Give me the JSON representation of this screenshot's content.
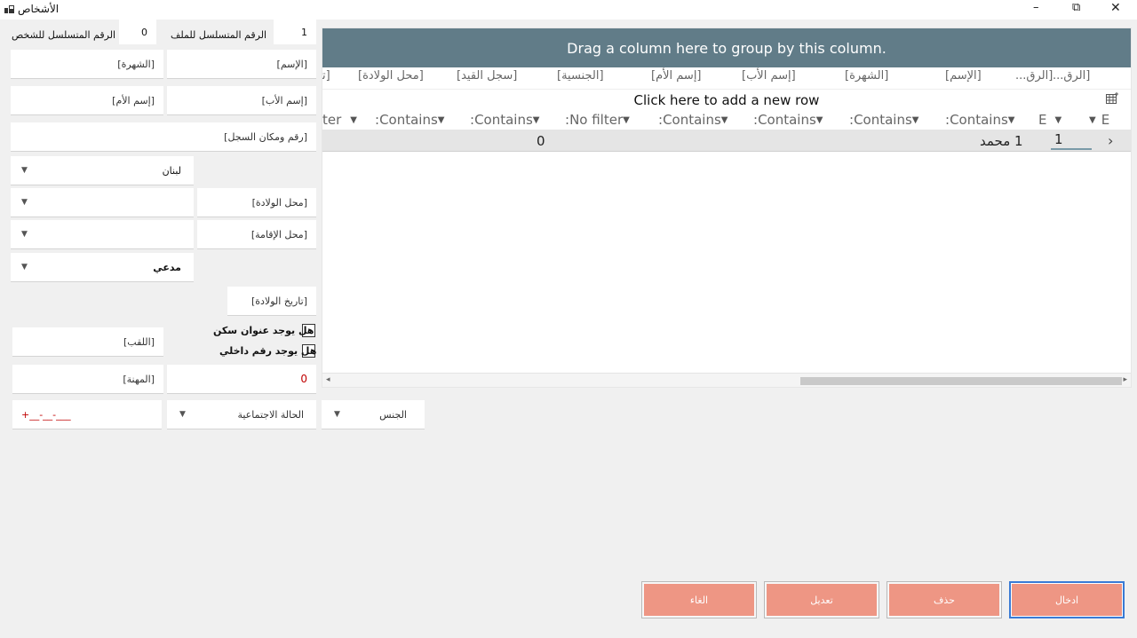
{
  "window": {
    "title": "الأشخاص",
    "minimize": "–",
    "restore": "⧉",
    "close": "✕"
  },
  "top": {
    "file_serial_value": "1",
    "file_serial_label": "الرقم المتسلسل للملف",
    "person_serial_value": "0",
    "person_serial_label": "الرقم المتسلسل للشخص"
  },
  "form": {
    "name_placeholder": "[الإسم]",
    "nickname_placeholder": "[الشهرة]",
    "father_placeholder": "[إسم الأب]",
    "mother_placeholder": "[إسم الأم]",
    "registry_placeholder": "[رقم ومكان السجل]",
    "nationality_value": "لبنان",
    "birthplace_placeholder": "[محل الولادة]",
    "residence_placeholder": "[محل الإقامة]",
    "role_value": "مدعي",
    "birthdate_placeholder": "[تاريخ الولادة]",
    "has_address_label": "هل يوجد عنوان سكن",
    "has_internal_number_label": "هل يوجد رقم داخلي",
    "title_placeholder": "[اللقب]",
    "profession_placeholder": "[المهنة]",
    "number_value": "0",
    "phone_value": "+__-__-___",
    "marital_status_placeholder": "الحالة الاجتماعية",
    "gender_placeholder": "الجنس"
  },
  "grid": {
    "group_text": "Drag a column here to group by this column.",
    "add_row_text": "Click here to add a new row",
    "headers": [
      "[الرق...",
      "[الرق...",
      "[الإسم]",
      "[الشهرة]",
      "[إسم الأب]",
      "[إسم الأم]",
      "[الجنسية]",
      "[سجل القيد]",
      "[محل الولادة]",
      "[تا"
    ],
    "filters": [
      "E",
      "E",
      "Contains:",
      "Contains:",
      "Contains:",
      "Contains:",
      "No filter:",
      "Contains:",
      "Contains:",
      "ter"
    ],
    "row": {
      "indicator": "›",
      "col1": "1",
      "col2": "1 محمد",
      "col3": "0"
    }
  },
  "buttons": {
    "enter": "ادخال",
    "delete": "حذف",
    "edit": "تعديل",
    "cancel": "الغاء"
  },
  "colors": {
    "group_bar": "#617c88",
    "button": "#ee9684",
    "number_value": "#c00000"
  },
  "icons": {
    "app": "app-icon",
    "column_chooser": "column-chooser-icon",
    "filter": "filter-icon",
    "dropdown": "chevron-down-icon"
  }
}
